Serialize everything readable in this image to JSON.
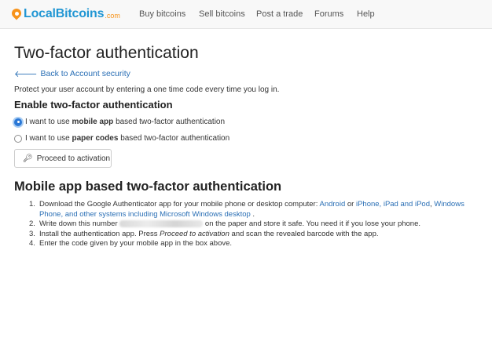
{
  "brand": {
    "name": "LocalBitcoins",
    "domain": ".com",
    "accent": "#2196d3",
    "orange": "#f7931a"
  },
  "nav": [
    {
      "label": "Buy bitcoins"
    },
    {
      "label": "Sell bitcoins"
    },
    {
      "label": "Post a trade"
    },
    {
      "label": "Forums"
    },
    {
      "label": "Help"
    }
  ],
  "page": {
    "title": "Two-factor authentication",
    "back_link": "Back to Account security",
    "intro": "Protect your user account by entering a one time code every time you log in.",
    "enable_heading": "Enable two-factor authentication",
    "option_mobile": {
      "pre": "I want to use ",
      "bold": "mobile app",
      "post": " based two-factor authentication",
      "checked": true
    },
    "option_paper": {
      "pre": "I want to use ",
      "bold": "paper codes",
      "post": " based two-factor authentication",
      "checked": false
    },
    "proceed_button": "Proceed to activation",
    "mobile_heading": "Mobile app based two-factor authentication"
  },
  "steps": {
    "s1": {
      "num": "1.",
      "text_a": "Download the Google Authenticator app for your mobile phone or desktop computer: ",
      "link_android": "Android",
      "or": " or ",
      "link_ios": "iPhone, iPad and iPod",
      "comma": ", ",
      "link_windows": "Windows Phone, and other systems including Microsoft Windows desktop",
      "end": " ."
    },
    "s2": {
      "num": "2.",
      "text_a": "Write down this number ",
      "text_b": " on the paper and store it safe. You need it if you lose your phone."
    },
    "s3": {
      "num": "3.",
      "text_a": "Install the authentication app. Press ",
      "em": "Proceed to activation",
      "text_b": " and scan the revealed barcode with the app."
    },
    "s4": {
      "num": "4.",
      "text": "Enter the code given by your mobile app in the box above."
    }
  }
}
